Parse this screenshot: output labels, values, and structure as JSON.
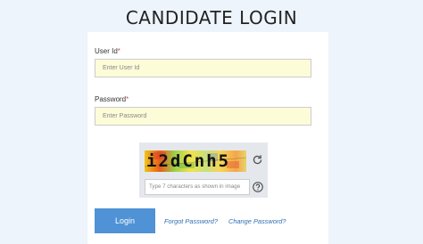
{
  "page": {
    "title": "CANDIDATE LOGIN"
  },
  "form": {
    "user_id": {
      "label": "User Id",
      "required_mark": "*",
      "placeholder": "Enter User Id",
      "value": ""
    },
    "password": {
      "label": "Password",
      "required_mark": "*",
      "placeholder": "Enter Password",
      "value": ""
    },
    "captcha": {
      "image_text": "i2dCnh5",
      "input_placeholder": "Type 7 characters as shown in image",
      "refresh_icon": "refresh-icon",
      "help_icon": "question-icon"
    },
    "login_label": "Login",
    "forgot_password_label": "Forgot Password?",
    "change_password_label": "Change Password?"
  },
  "colors": {
    "background": "#eef4fb",
    "input_fill": "#fdfcd8",
    "button": "#4f92d6",
    "link": "#2f6fb3",
    "required": "#d9534f"
  }
}
